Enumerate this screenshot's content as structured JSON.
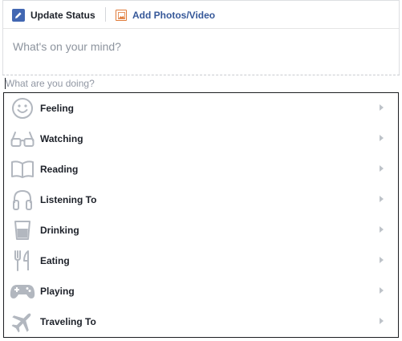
{
  "composer": {
    "tabs": [
      {
        "label": "Update Status",
        "icon": "pencil-icon"
      },
      {
        "label": "Add Photos/Video",
        "icon": "photo-icon"
      }
    ],
    "prompt": "What's on your mind?"
  },
  "activity_input": {
    "value": "",
    "placeholder": "What are you doing?"
  },
  "activities": [
    {
      "label": "Feeling",
      "icon": "smiley-icon"
    },
    {
      "label": "Watching",
      "icon": "glasses-icon"
    },
    {
      "label": "Reading",
      "icon": "book-icon"
    },
    {
      "label": "Listening To",
      "icon": "headphones-icon"
    },
    {
      "label": "Drinking",
      "icon": "cup-icon"
    },
    {
      "label": "Eating",
      "icon": "fork-knife-icon"
    },
    {
      "label": "Playing",
      "icon": "gamepad-icon"
    },
    {
      "label": "Traveling To",
      "icon": "airplane-icon"
    }
  ],
  "colors": {
    "accent": "#4267b2",
    "link": "#365899",
    "photo_icon": "#e07b39",
    "icon_gray": "#b2b7bf",
    "placeholder": "#9197a3"
  }
}
